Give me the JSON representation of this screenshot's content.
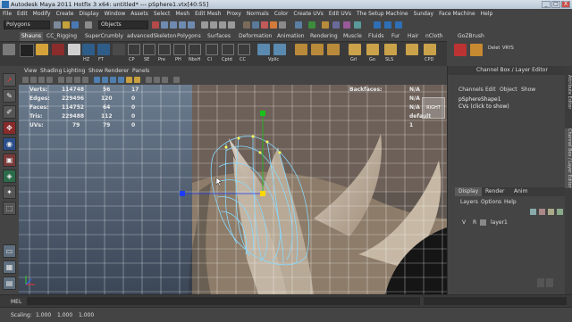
{
  "window": {
    "title": "Autodesk Maya 2011 Hotfix 3 x64: untitled*   ---   pSphere1.vtx[40:55]",
    "minimize": "_",
    "maximize": "□",
    "close": "X"
  },
  "menubar": [
    "File",
    "Edit",
    "Modify",
    "Create",
    "Display",
    "Window",
    "Assets",
    "Select",
    "Mesh",
    "Edit Mesh",
    "Proxy",
    "Normals",
    "Color",
    "Create UVs",
    "Edit UVs",
    "The Setup Machine",
    "Sunday",
    "Face Machine",
    "Help"
  ],
  "statusline": {
    "menuset": "Polygons",
    "selection_field": "Objects"
  },
  "shelf": {
    "tabs": [
      "Shauns",
      "CC_Rigging",
      "SuperCrumbly",
      "advancedSkeleton",
      "Polygons",
      "Surfaces",
      "Deformation",
      "Animation",
      "Rendering",
      "Muscle",
      "Fluids",
      "Fur",
      "Hair",
      "nCloth",
      "GoZBrush"
    ],
    "active_tab": "Shauns",
    "icons": [
      "HZ",
      "FT",
      "CP",
      "SE",
      "Pre",
      "PH",
      "NbsH",
      "CI",
      "Cptd",
      "CC",
      "Vplic",
      "Grl",
      "Go",
      "SLS",
      "CPD",
      "Delet",
      "VRYS"
    ]
  },
  "viewport": {
    "menu": [
      "View",
      "Shading",
      "Lighting",
      "Show",
      "Renderer",
      "Panels"
    ],
    "hud_left": [
      {
        "label": "Verts:",
        "a": "114748",
        "b": "56",
        "c": "17"
      },
      {
        "label": "Edges:",
        "a": "229496",
        "b": "120",
        "c": "0"
      },
      {
        "label": "Faces:",
        "a": "114752",
        "b": "64",
        "c": "0"
      },
      {
        "label": "Tris:",
        "a": "229488",
        "b": "112",
        "c": "0"
      },
      {
        "label": "UVs:",
        "a": "79",
        "b": "79",
        "c": "0"
      }
    ],
    "hud_right": [
      {
        "label": "Backfaces:",
        "value": "N/A"
      },
      {
        "label": "",
        "value": "N/A"
      },
      {
        "label": "",
        "value": "N/A"
      },
      {
        "label": "",
        "value": "default"
      },
      {
        "label": "",
        "value": "1"
      }
    ],
    "view_cube_label": "RIGHT",
    "colors": {
      "grid": "#ffffff",
      "cage": "#88d9ff",
      "handle_x": "#1e3cff",
      "handle_y": "#19c219",
      "handle_z": "#ffd800"
    }
  },
  "channel_box": {
    "header": "Channel Box / Layer Editor",
    "menu": [
      "Channels",
      "Edit",
      "Object",
      "Show"
    ],
    "node": "pSphereShape1",
    "cvs_text": "CVs (click to show)",
    "side_tabs": [
      "Attribute Editor",
      "Channel Box / Layer Editor"
    ],
    "layer_tabs": [
      "Display",
      "Render",
      "Anim"
    ],
    "active_layer_tab": "Display",
    "layer_menu": [
      "Layers",
      "Options",
      "Help"
    ],
    "layer": {
      "v": "V",
      "r": "R",
      "name": "layer1"
    }
  },
  "cmdline": {
    "label": "MEL"
  },
  "helpline": {
    "scaling_label": "Scaling:",
    "x": "1.000",
    "y": "1.000",
    "z": "1.000"
  }
}
